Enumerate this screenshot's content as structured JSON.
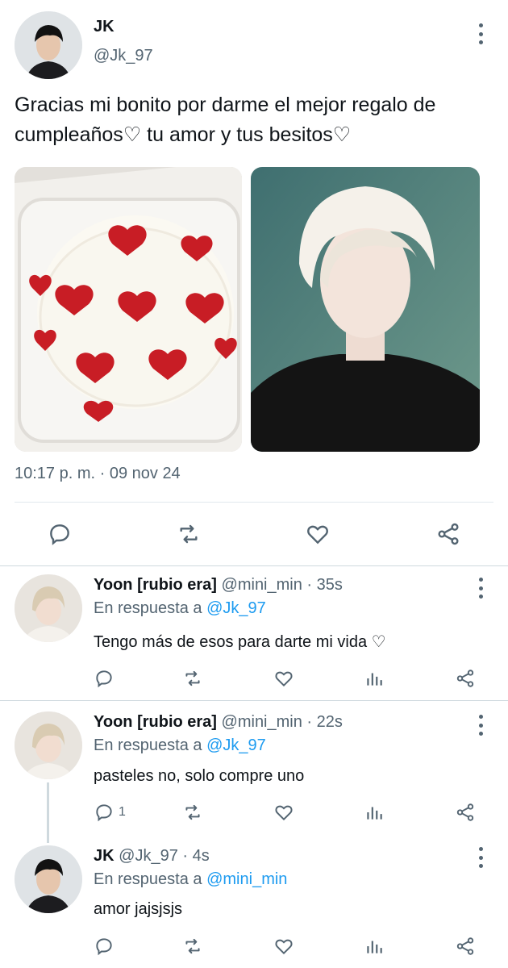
{
  "main_tweet": {
    "author_name": "JK",
    "author_handle": "@Jk_97",
    "text": "Gracias mi bonito por darme el mejor regalo de cumpleaños♡ tu amor y tus besitos♡",
    "timestamp": "10:17 p. m. · 09 nov 24"
  },
  "replies": [
    {
      "author_name": "Yoon [rubio era]",
      "author_handle": "@mini_min",
      "time": "· 35s",
      "reply_prefix": "En respuesta a",
      "reply_to": "@Jk_97",
      "text": "Tengo más de esos para darte mi vida ♡",
      "reply_count": ""
    },
    {
      "author_name": "Yoon [rubio era]",
      "author_handle": "@mini_min",
      "time": "· 22s",
      "reply_prefix": "En respuesta a",
      "reply_to": "@Jk_97",
      "text": "pasteles no, solo compre uno",
      "reply_count": "1"
    },
    {
      "author_name": "JK",
      "author_handle": "@Jk_97",
      "time": "· 4s",
      "reply_prefix": "En respuesta a",
      "reply_to": "@mini_min",
      "text": "amor jajsjsjs",
      "reply_count": ""
    }
  ],
  "colors": {
    "link": "#1d9bf0",
    "secondary_text": "#536471",
    "primary_text": "#0f1419",
    "border": "#cfd9de"
  }
}
